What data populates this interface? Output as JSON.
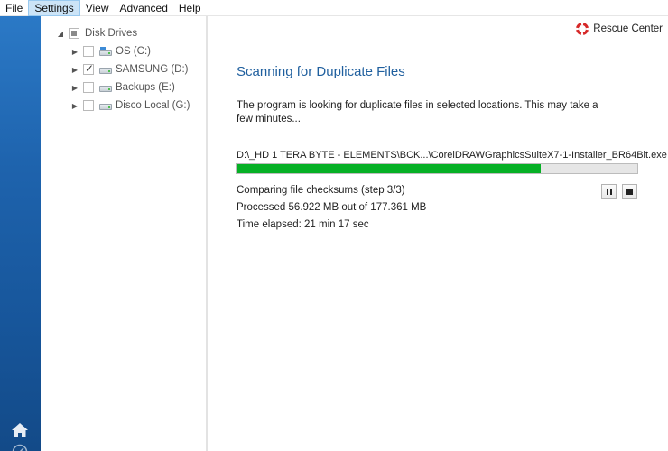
{
  "menu": {
    "items": [
      {
        "label": "File"
      },
      {
        "label": "Settings"
      },
      {
        "label": "View"
      },
      {
        "label": "Advanced"
      },
      {
        "label": "Help"
      }
    ]
  },
  "tree": {
    "root": {
      "label": "Disk Drives"
    },
    "drives": [
      {
        "label": "OS (C:)",
        "checked": false
      },
      {
        "label": "SAMSUNG (D:)",
        "checked": true
      },
      {
        "label": "Backups (E:)",
        "checked": false
      },
      {
        "label": "Disco Local (G:)",
        "checked": false
      }
    ]
  },
  "header": {
    "rescue_label": "Rescue Center"
  },
  "scan": {
    "title": "Scanning for Duplicate Files",
    "description": "The program is looking for duplicate files in selected locations. This may take a few minutes...",
    "current_file": "D:\\_HD 1 TERA BYTE - ELEMENTS\\BCK...\\CorelDRAWGraphicsSuiteX7-1-Installer_BR64Bit.exe",
    "progress_fraction": 0.76,
    "step_text": "Comparing file checksums (step 3/3)",
    "processed_text": "Processed 56.922 MB out of 177.361 MB",
    "elapsed_text": "Time elapsed: 21 min 17 sec"
  },
  "colors": {
    "accent": "#1f5f9e",
    "progress": "#06b025",
    "rail": "#1e63ad"
  },
  "icons": {
    "pause": "pause-icon",
    "stop": "stop-icon",
    "home": "home-icon",
    "rescue": "lifebuoy-icon"
  }
}
